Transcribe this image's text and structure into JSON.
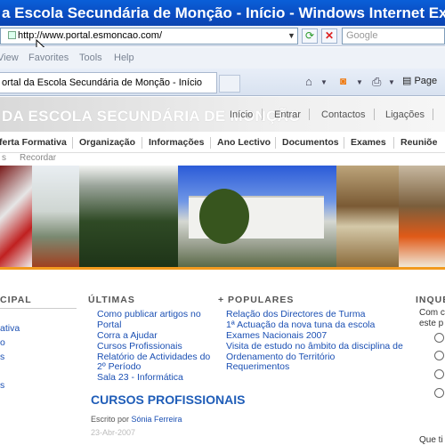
{
  "window": {
    "title": "a Escola Secundária de Monção - Início - Windows Internet Explorer"
  },
  "address": {
    "url": "http://www.portal.esmoncao.com/",
    "search_placeholder": "Google"
  },
  "menu": {
    "items": [
      "View",
      "Favorites",
      "Tools",
      "Help"
    ]
  },
  "tab": {
    "title": "ortal da Escola Secundária de Monção - Início"
  },
  "toolbar": {
    "page_label": "Page"
  },
  "site": {
    "title": "DA ESCOLA SECUNDÁRIA DE MONÇÃO",
    "top_nav": [
      "Início",
      "Entrar",
      "Contactos",
      "Ligações"
    ],
    "main_nav": [
      "ferta Formativa",
      "Organização",
      "Informações",
      "Ano Lectivo",
      "Documentos",
      "Exames",
      "Reuniõe"
    ],
    "sub_nav": [
      "s",
      "Recordar"
    ]
  },
  "columns": {
    "left_head": "CIPAL",
    "left_links": [
      "ativa",
      "o",
      "s",
      "s"
    ],
    "ultimas_head": "ÚLTIMAS",
    "ultimas_links": [
      "Como publicar artigos no",
      "Portal",
      "Corra a Ajudar",
      "Cursos Profissionais",
      "Relatório de Actividades do",
      "2º Período",
      "Sala 23 - Informática"
    ],
    "populares_head": "+ POPULARES",
    "populares_links": [
      "Relação dos Directores de Turma",
      "1ª Actuação da nova tuna da escola",
      "Exames Nacionais 2007",
      "Visita de estudo no âmbito da disciplina de",
      "Ordenamento do Território",
      "Requerimentos"
    ],
    "poll_head": "INQUÉ",
    "poll_lines": [
      "Com c",
      "este p"
    ],
    "poll_footer": "Que ti"
  },
  "article": {
    "title": "CURSOS PROFISSIONAIS",
    "byline_prefix": "Escrito por",
    "author": "Sónia Ferreira",
    "date": "23-Abr-2007"
  },
  "colors": {
    "accent": "#f29a1e",
    "link": "#1a4fb3",
    "title_blue": "#1f5db8",
    "ie_title": "#0a4bc0"
  }
}
